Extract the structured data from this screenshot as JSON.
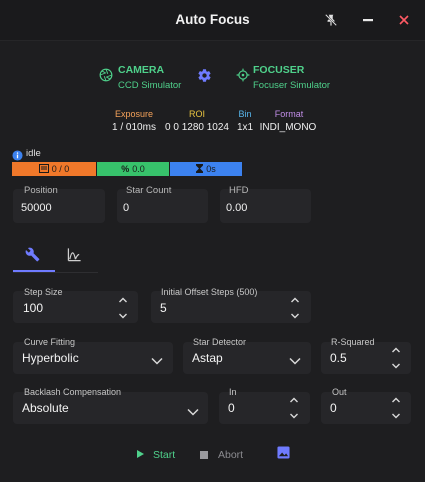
{
  "window": {
    "title": "Auto Focus",
    "controls": {
      "pin": "pin-off-icon",
      "minimize": "minimize-icon",
      "close": "close-icon"
    }
  },
  "camera": {
    "label": "CAMERA",
    "name": "CCD Simulator",
    "icon": "aperture-icon"
  },
  "settings_icon": "gear-icon",
  "focuser": {
    "label": "FOCUSER",
    "name": "Focuser Simulator",
    "icon": "crosshair-icon"
  },
  "camera_info": {
    "exposure_label": "Exposure",
    "exposure_value": "1 / 010ms",
    "roi_label": "ROI",
    "roi_value": "0 0 1280 1024",
    "bin_label": "Bin",
    "bin_value": "1x1",
    "format_label": "Format",
    "format_value": "INDI_MONO"
  },
  "status": {
    "text": "idle",
    "frames": "0 / 0",
    "progress": "0.0",
    "elapsed": "0s"
  },
  "stats": {
    "position_label": "Position",
    "position_value": "50000",
    "star_count_label": "Star Count",
    "star_count_value": "0",
    "hfd_label": "HFD",
    "hfd_value": "0.00"
  },
  "tabs": [
    {
      "name": "settings",
      "icon": "wrench-icon",
      "active": true
    },
    {
      "name": "chart",
      "icon": "chart-icon",
      "active": false
    }
  ],
  "form": {
    "step_size_label": "Step Size",
    "step_size_value": "100",
    "initial_offset_label": "Initial Offset Steps (500)",
    "initial_offset_value": "5",
    "curve_fitting_label": "Curve Fitting",
    "curve_fitting_value": "Hyperbolic",
    "star_detector_label": "Star Detector",
    "star_detector_value": "Astap",
    "r_squared_label": "R-Squared",
    "r_squared_value": "0.5",
    "backlash_label": "Backlash Compensation",
    "backlash_value": "Absolute",
    "in_label": "In",
    "in_value": "0",
    "out_label": "Out",
    "out_value": "0"
  },
  "actions": {
    "start": "Start",
    "abort": "Abort",
    "image_icon": "image-icon"
  },
  "colors": {
    "accent": "#6f7bff",
    "green": "#4fd18b",
    "orange": "#f0782a",
    "seg_green": "#37c26b",
    "seg_blue": "#3c82f0",
    "exposure": "#f5a25a",
    "roi": "#e9c440",
    "bin": "#58b6ec",
    "format": "#c28ee8"
  }
}
